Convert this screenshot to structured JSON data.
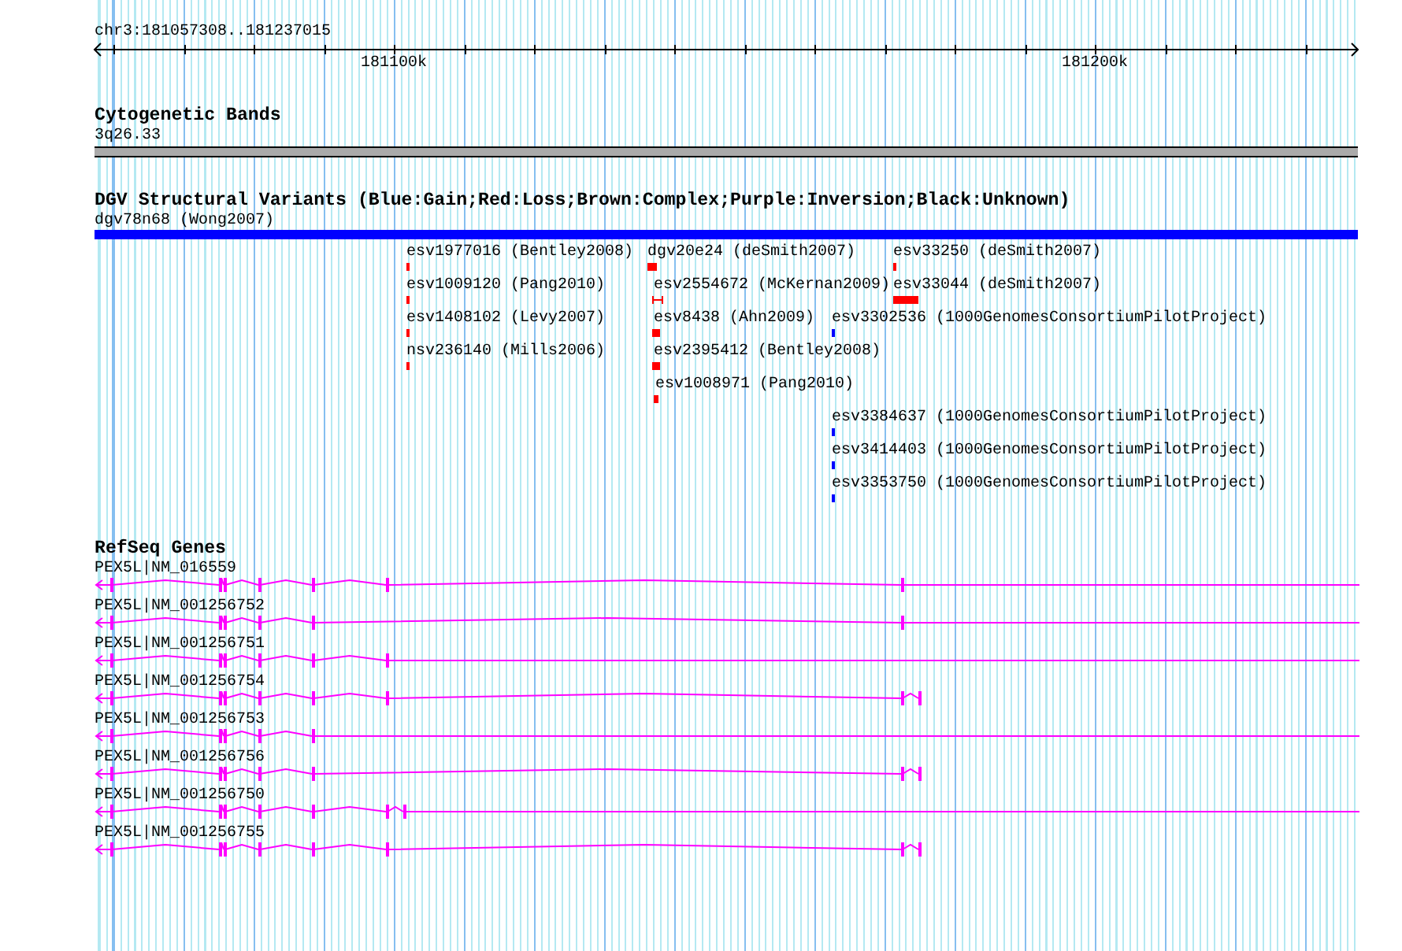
{
  "ruler": {
    "position": "chr3:181057308..181237015",
    "ticks": [
      "181100k",
      "181200k"
    ]
  },
  "cytogenetic_bands": {
    "title": "Cytogenetic Bands",
    "band": "3q26.33"
  },
  "dgv": {
    "title": "DGV Structural Variants (Blue:Gain;Red:Loss;Brown:Complex;Purple:Inversion;Black:Unknown)",
    "top_variant": {
      "label": "dgv78n68 (Wong2007)",
      "color": "#0000ff"
    },
    "variants": [
      {
        "label": "esv1977016 (Bentley2008)",
        "color": "#ff0000"
      },
      {
        "label": "dgv20e24 (deSmith2007)",
        "color": "#ff0000"
      },
      {
        "label": "esv33250 (deSmith2007)",
        "color": "#ff0000"
      },
      {
        "label": "esv1009120 (Pang2010)",
        "color": "#ff0000"
      },
      {
        "label": "esv2554672 (McKernan2009)",
        "color": "#ff0000"
      },
      {
        "label": "esv33044 (deSmith2007)",
        "color": "#ff0000"
      },
      {
        "label": "esv1408102 (Levy2007)",
        "color": "#ff0000"
      },
      {
        "label": "esv8438 (Ahn2009)",
        "color": "#ff0000"
      },
      {
        "label": "esv3302536 (1000GenomesConsortiumPilotProject)",
        "color": "#0000ff"
      },
      {
        "label": "nsv236140 (Mills2006)",
        "color": "#ff0000"
      },
      {
        "label": "esv2395412 (Bentley2008)",
        "color": "#ff0000"
      },
      {
        "label": "esv1008971 (Pang2010)",
        "color": "#ff0000"
      },
      {
        "label": "esv3384637 (1000GenomesConsortiumPilotProject)",
        "color": "#0000ff"
      },
      {
        "label": "esv3414403 (1000GenomesConsortiumPilotProject)",
        "color": "#0000ff"
      },
      {
        "label": "esv3353750 (1000GenomesConsortiumPilotProject)",
        "color": "#0000ff"
      }
    ]
  },
  "refseq": {
    "title": "RefSeq Genes",
    "genes": [
      {
        "label": "PEX5L|NM_016559"
      },
      {
        "label": "PEX5L|NM_001256752"
      },
      {
        "label": "PEX5L|NM_001256751"
      },
      {
        "label": "PEX5L|NM_001256754"
      },
      {
        "label": "PEX5L|NM_001256753"
      },
      {
        "label": "PEX5L|NM_001256756"
      },
      {
        "label": "PEX5L|NM_001256750"
      },
      {
        "label": "PEX5L|NM_001256755"
      }
    ]
  }
}
